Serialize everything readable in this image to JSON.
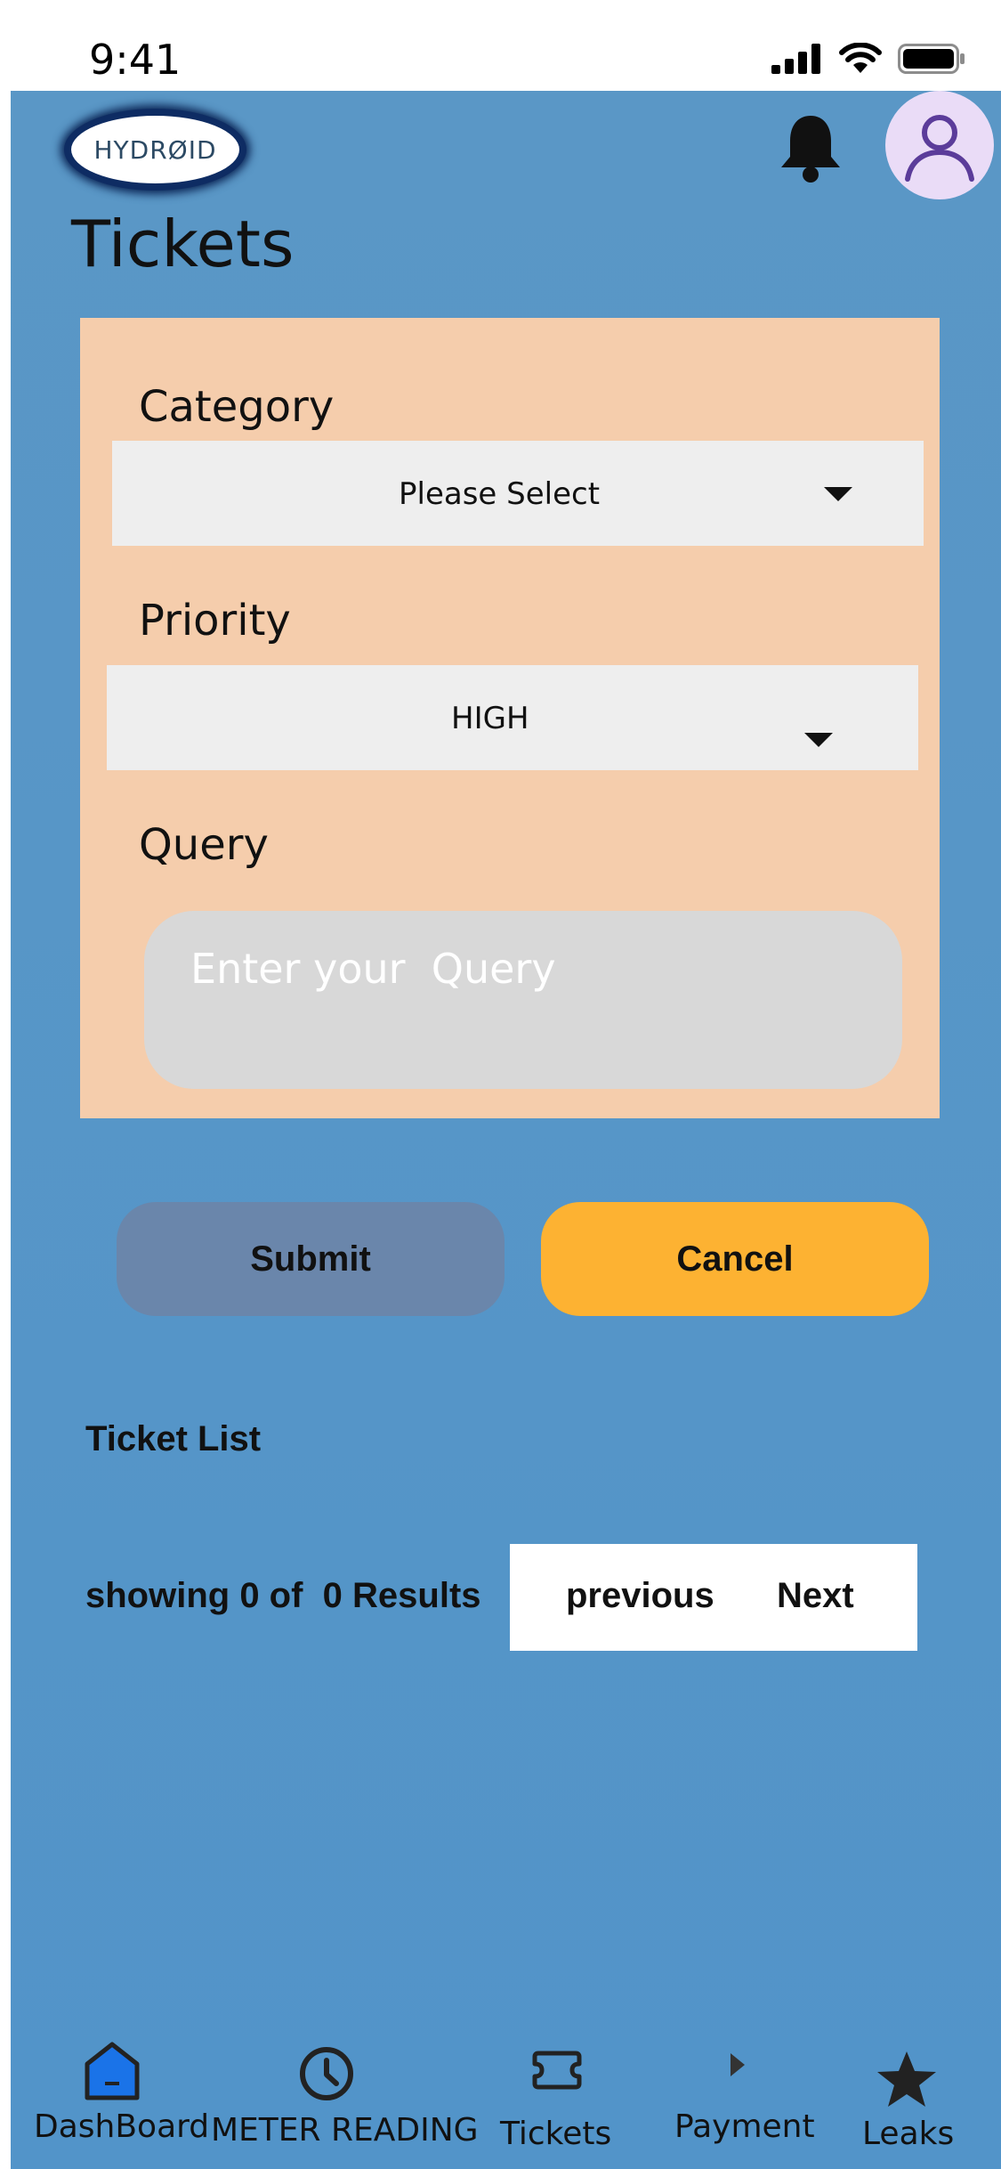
{
  "status_bar": {
    "time": "9:41"
  },
  "header": {
    "logo_text": "HYDRØID",
    "page_title": "Tickets"
  },
  "form": {
    "category": {
      "label": "Category",
      "value": "Please  Select"
    },
    "priority": {
      "label": "Priority",
      "value": "HIGH"
    },
    "query": {
      "label": "Query",
      "placeholder": "Enter your  Query"
    }
  },
  "actions": {
    "submit_label": "Submit",
    "cancel_label": "Cancel"
  },
  "ticket_list": {
    "title": "Ticket List",
    "results_text": "showing 0 of  0 Results",
    "previous_label": "previous",
    "next_label": "Next"
  },
  "bottom_nav": {
    "items": [
      {
        "label": "DashBoard",
        "icon": "home-icon"
      },
      {
        "label": "METER READING",
        "icon": "clock-icon"
      },
      {
        "label": "Tickets",
        "icon": "ticket-icon"
      },
      {
        "label": "Payment",
        "icon": "play-icon"
      },
      {
        "label": "Leaks",
        "icon": "star-icon"
      }
    ]
  },
  "colors": {
    "background": "#5a97c6",
    "form_card": "#f5cdac",
    "submit_button": "#6a86ab",
    "cancel_button": "#fdb232",
    "dashboard_icon": "#1a73e8"
  }
}
